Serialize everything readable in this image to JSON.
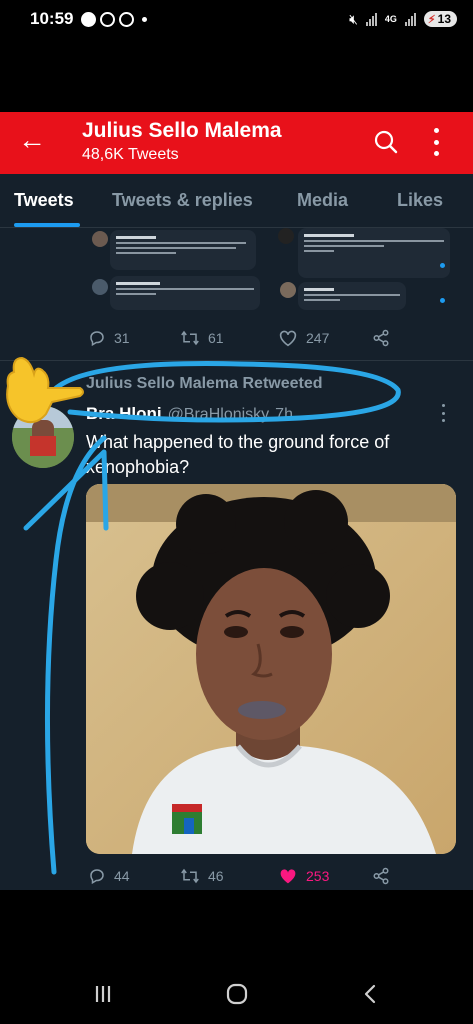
{
  "status_bar": {
    "time": "10:59",
    "network": "4G",
    "battery": "13"
  },
  "header": {
    "profile_name": "Julius Sello Malema",
    "tweet_count": "48,6K Tweets"
  },
  "tabs": [
    {
      "label": "Tweets",
      "active": true
    },
    {
      "label": "Tweets & replies",
      "active": false
    },
    {
      "label": "Media",
      "active": false
    },
    {
      "label": "Likes",
      "active": false
    }
  ],
  "previous_tweet": {
    "replies": "31",
    "retweets": "61",
    "likes": "247"
  },
  "tweet": {
    "retweeted_by": "Julius Sello Malema Retweeted",
    "author_name": "Bra Hloni",
    "author_handle": "@BraHlonisky",
    "age": "7h",
    "text": "What happened to the ground force of xenophobia?",
    "replies": "44",
    "retweets": "46",
    "likes": "253"
  },
  "colors": {
    "header_red": "#e8111a",
    "background": "#15202b",
    "accent_blue": "#1d9bf0",
    "like_pink": "#f91880",
    "muted": "#8899a6",
    "annotation_blue": "#2aa6e6"
  },
  "icons": [
    "back-arrow-icon",
    "search-icon",
    "more-vertical-icon",
    "reply-icon",
    "retweet-icon",
    "heart-icon",
    "share-icon",
    "pointing-hand-emoji",
    "recents-icon",
    "home-icon",
    "back-icon"
  ]
}
